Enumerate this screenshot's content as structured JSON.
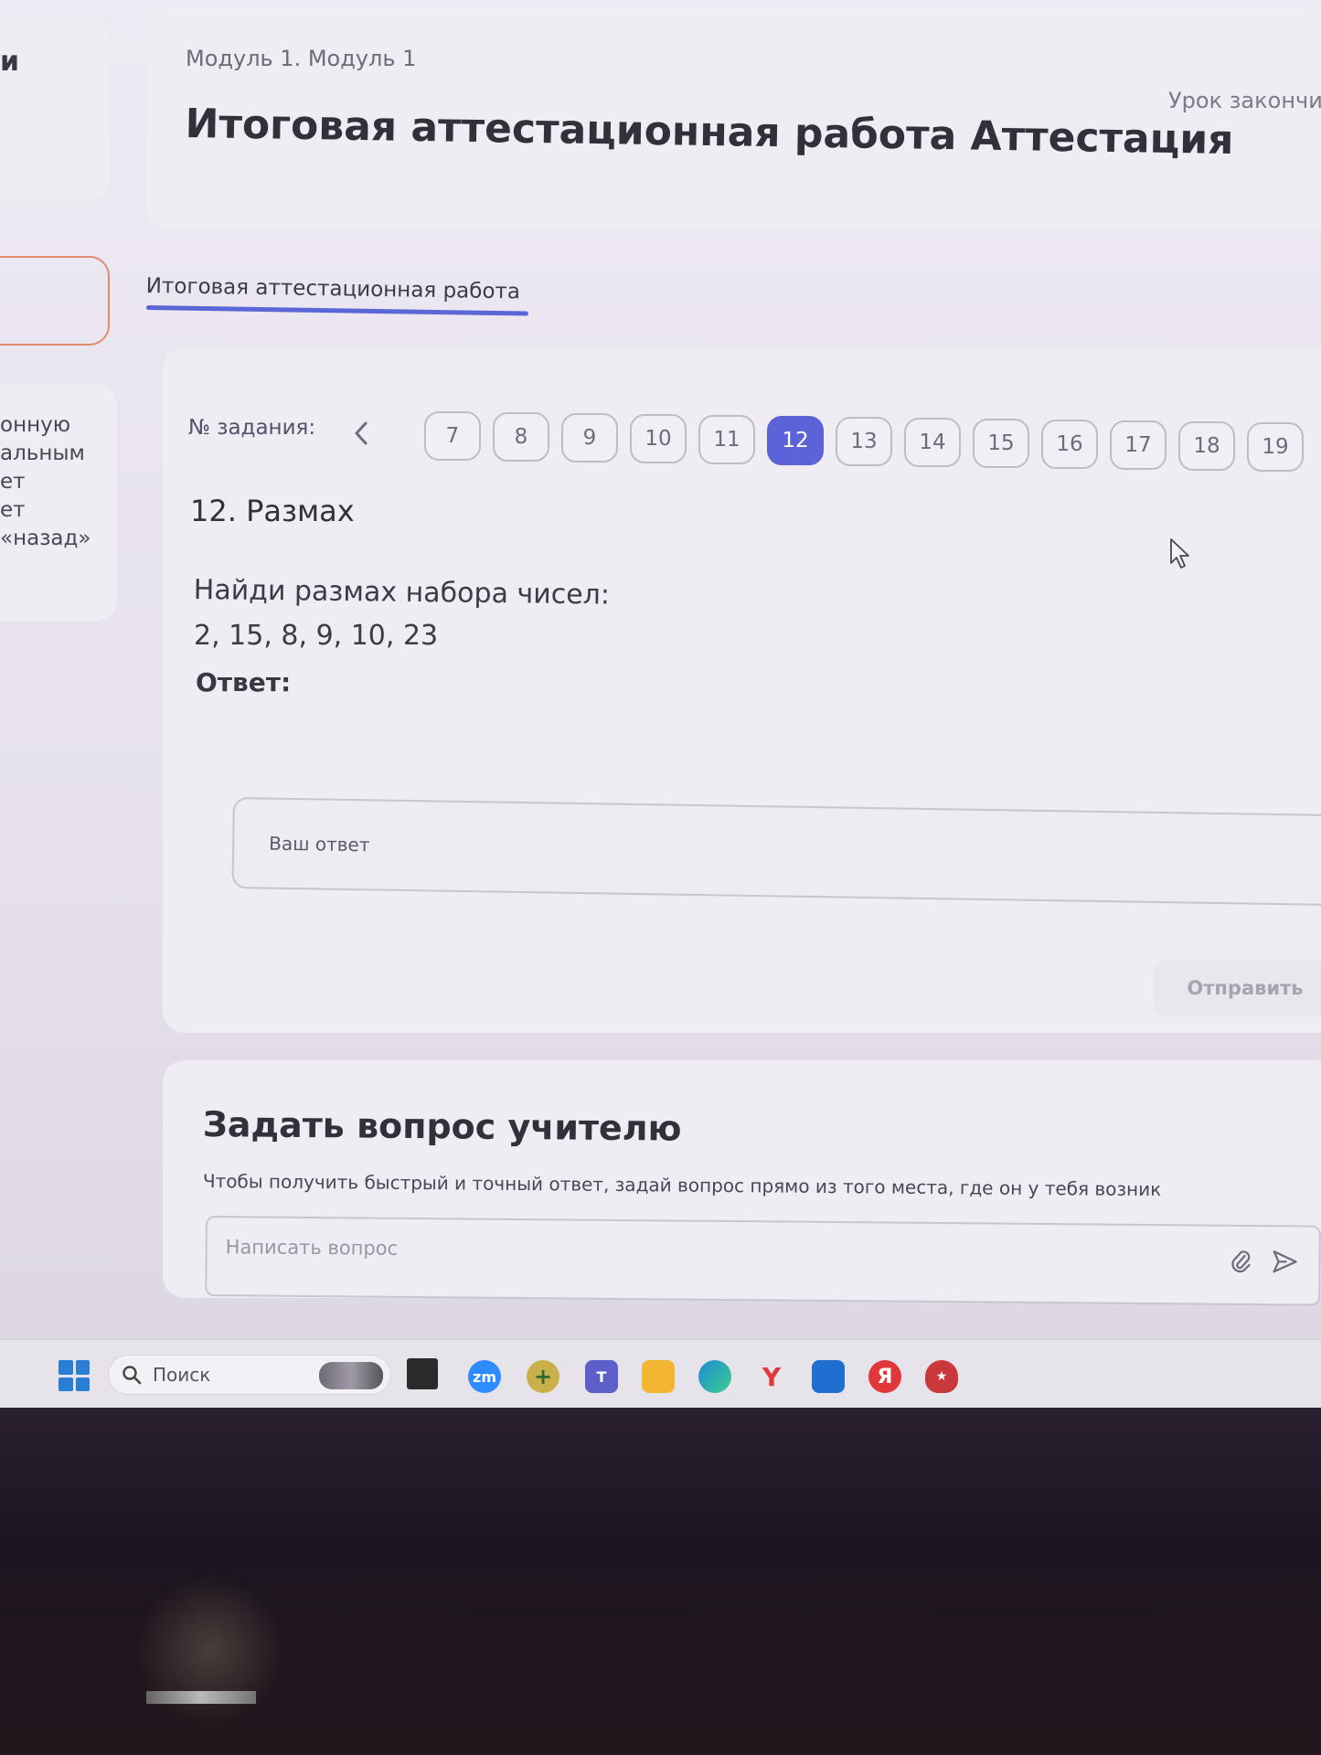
{
  "sidebar": {
    "top_letter": "и",
    "fragments": [
      "онную",
      "альным",
      "ет",
      "ет",
      "«назад»"
    ]
  },
  "header": {
    "breadcrumb": "Модуль 1. Модуль 1",
    "title": "Итоговая аттестационная работа Аттестация",
    "lesson_status": "Урок закончи"
  },
  "tabs": {
    "active_label": "Итоговая аттестационная работа"
  },
  "task_nav": {
    "label": "№ задания:",
    "numbers": [
      "7",
      "8",
      "9",
      "10",
      "11",
      "12",
      "13",
      "14",
      "15",
      "16",
      "17",
      "18",
      "19"
    ],
    "active": "12"
  },
  "task": {
    "heading": "12. Размах",
    "text": "Найди размах набора чисел:",
    "numbers": "2, 15, 8, 9, 10, 23",
    "answer_label": "Ответ:",
    "answer_placeholder": "Ваш ответ",
    "submit_label": "Отправить"
  },
  "ask_teacher": {
    "title": "Задать вопрос учителю",
    "description": "Чтобы получить быстрый и точный ответ, задай вопрос прямо из того места, где он у тебя возник",
    "placeholder": "Написать вопрос"
  },
  "taskbar": {
    "search_label": "Поиск",
    "apps": [
      {
        "name": "zoom-icon",
        "label": "zm",
        "color": "#2d8cff"
      },
      {
        "name": "teams-icon",
        "label": "",
        "color": "#5b5fc7"
      },
      {
        "name": "folder-icon",
        "label": "",
        "color": "#f2b632"
      },
      {
        "name": "edge-icon",
        "label": "",
        "color": "#1e8ad6"
      },
      {
        "name": "yandex-browser-icon",
        "label": "Y",
        "color": "#e8e4ee"
      },
      {
        "name": "store-icon",
        "label": "",
        "color": "#1f6fd0"
      },
      {
        "name": "yandex-icon",
        "label": "Я",
        "color": "#e0383a"
      },
      {
        "name": "shield-app-icon",
        "label": "",
        "color": "#c9383a"
      }
    ]
  }
}
